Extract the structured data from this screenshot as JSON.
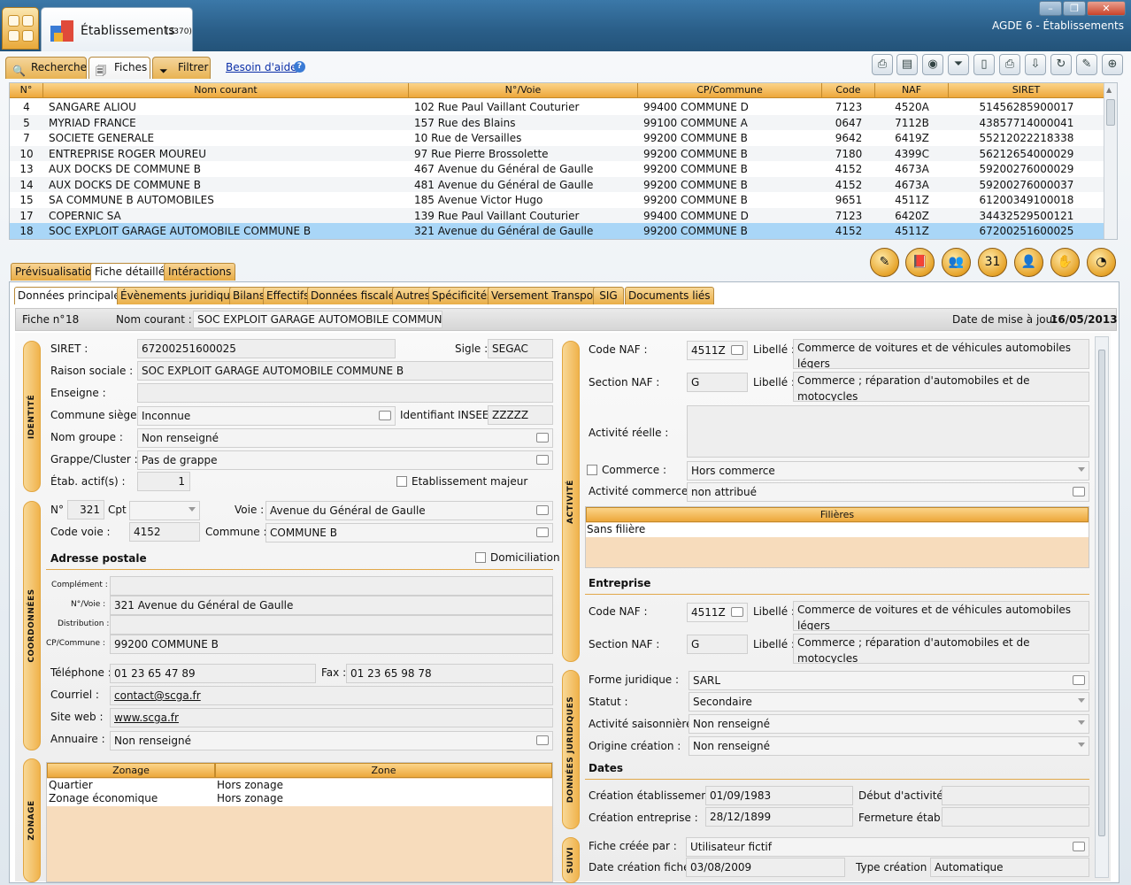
{
  "window": {
    "app_title": "AGDE 6 - Établissements",
    "tab_title": "Établissements",
    "tab_count": "(3370)"
  },
  "toolbar": {
    "tabs": [
      {
        "label": "Recherche",
        "icon": "search-icon"
      },
      {
        "label": "Fiches",
        "icon": "cards-icon"
      },
      {
        "label": "Filtrer",
        "icon": "filter-icon"
      }
    ],
    "help": "Besoin d'aide",
    "help_icon": "?"
  },
  "grid": {
    "columns": [
      "N°",
      "Nom courant",
      "N°/Voie",
      "CP/Commune",
      "Code",
      "NAF",
      "SIRET"
    ],
    "rows": [
      [
        "4",
        "SANGARE ALIOU",
        "102 Rue Paul Vaillant Couturier",
        "99400 COMMUNE D",
        "7123",
        "4520A",
        "51456285900017"
      ],
      [
        "5",
        "MYRIAD FRANCE",
        "157 Rue des Blains",
        "99100 COMMUNE A",
        "0647",
        "7112B",
        "43857714000041"
      ],
      [
        "7",
        "SOCIETE GENERALE",
        "10 Rue de Versailles",
        "99200 COMMUNE B",
        "9642",
        "6419Z",
        "55212022218338"
      ],
      [
        "10",
        "ENTREPRISE ROGER MOUREU",
        "97 Rue Pierre Brossolette",
        "99200 COMMUNE B",
        "7180",
        "4399C",
        "56212654000029"
      ],
      [
        "13",
        "AUX DOCKS DE COMMUNE B",
        "467 Avenue du Général de Gaulle",
        "99200 COMMUNE B",
        "4152",
        "4673A",
        "59200276000029"
      ],
      [
        "14",
        "AUX DOCKS DE COMMUNE B",
        "481 Avenue du Général de Gaulle",
        "99200 COMMUNE B",
        "4152",
        "4673A",
        "59200276000037"
      ],
      [
        "15",
        "SA COMMUNE B AUTOMOBILES",
        "185 Avenue Victor Hugo",
        "99200 COMMUNE B",
        "9651",
        "4511Z",
        "61200349100018"
      ],
      [
        "17",
        "COPERNIC SA",
        "139  Rue Paul Vaillant Couturier",
        "99400 COMMUNE D",
        "7123",
        "6420Z",
        "34432529500121"
      ],
      [
        "18",
        "SOC EXPLOIT GARAGE AUTOMOBILE COMMUNE B",
        "321 Avenue du Général de Gaulle",
        "99200 COMMUNE B",
        "4152",
        "4511Z",
        "67200251600025"
      ]
    ],
    "selected_index": 8
  },
  "detail_tabs": [
    "Prévisualisation",
    "Fiche détaillée",
    "Intéractions"
  ],
  "inner_tabs": [
    "Données principales",
    "Évènements juridiques",
    "Bilans",
    "Effectifs",
    "Données fiscales",
    "Autres",
    "Spécificités",
    "Versement Transport",
    "SIG",
    "Documents liés"
  ],
  "info": {
    "fiche_label": "Fiche n°",
    "fiche_no": "18",
    "nom_label": "Nom courant :",
    "nom_value": "SOC EXPLOIT GARAGE AUTOMOBILE COMMUNE B",
    "maj_label": "Date de mise à jour :",
    "maj_value": "16/05/2013"
  },
  "sections": {
    "identite": "IDENTITÉ",
    "coordonnees": "COORDONNÉES",
    "zonage": "ZONAGE",
    "activite": "ACTIVITÉ",
    "juridique": "DONNÉES JURIDIQUES",
    "suivi": "SUIVI"
  },
  "identite": {
    "siret_l": "SIRET :",
    "siret": "67200251600025",
    "sigle_l": "Sigle :",
    "sigle": "SEGAC",
    "raison_l": "Raison sociale :",
    "raison": "SOC EXPLOIT GARAGE AUTOMOBILE COMMUNE B",
    "enseigne_l": "Enseigne :",
    "enseigne": "",
    "commune_l": "Commune siège :",
    "commune": "Inconnue",
    "insee_l": "Identifiant INSEE :",
    "insee": "ZZZZZ",
    "groupe_l": "Nom groupe :",
    "groupe": "Non renseigné",
    "grappe_l": "Grappe/Cluster :",
    "grappe": "Pas de grappe",
    "actif_l": "Étab. actif(s) :",
    "actif": "1",
    "majeur_l": "Etablissement majeur"
  },
  "coord": {
    "no_l": "N°",
    "no": "321",
    "cpt_l": "Cpt",
    "voie_l": "Voie :",
    "voie": "Avenue du Général de Gaulle",
    "codevoie_l": "Code voie :",
    "codevoie": "4152",
    "commune_l": "Commune :",
    "commune": "COMMUNE B",
    "adr_title": "Adresse postale",
    "domic_l": "Domiciliation",
    "compl_l": "Complément :",
    "compl": "",
    "nvoie_l": "N°/Voie :",
    "nvoie": "321 Avenue du Général de Gaulle",
    "distrib_l": "Distribution :",
    "distrib": "",
    "cp_l": "CP/Commune :",
    "cp": "99200 COMMUNE B",
    "tel_l": "Téléphone :",
    "tel": "01 23 65 47 89",
    "fax_l": "Fax :",
    "fax": "01 23 65 98 78",
    "mail_l": "Courriel :",
    "mail": "contact@scga.fr",
    "web_l": "Site web :",
    "web": "www.scga.fr",
    "annuaire_l": "Annuaire :",
    "annuaire": "Non renseigné"
  },
  "zonage": {
    "head": [
      "Zonage",
      "Zone"
    ],
    "rows": [
      [
        "Quartier",
        "Hors zonage"
      ],
      [
        "Zonage économique",
        "Hors zonage"
      ]
    ]
  },
  "activite": {
    "naf_l": "Code NAF :",
    "naf": "4511Z",
    "lib_l": "Libellé :",
    "naf_lib": "Commerce de voitures et de véhicules automobiles légers",
    "sec_l": "Section NAF :",
    "sec": "G",
    "sec_lib": "Commerce ; réparation d'automobiles et de motocycles",
    "reelle_l": "Activité réelle :",
    "reelle": "",
    "commerce_l": "Commerce :",
    "commerce": "Hors commerce",
    "actcom_l": "Activité commerce :",
    "actcom": "non attribué",
    "filieres_head": "Filières",
    "filiere": "Sans filière",
    "ent_title": "Entreprise",
    "e_naf": "4511Z",
    "e_naf_lib": "Commerce de voitures et de véhicules automobiles légers",
    "e_sec": "G",
    "e_sec_lib": "Commerce ; réparation d'automobiles et de motocycles"
  },
  "juridique": {
    "forme_l": "Forme juridique :",
    "forme": "SARL",
    "statut_l": "Statut :",
    "statut": "Secondaire",
    "saison_l": "Activité saisonnière :",
    "saison": "Non renseigné",
    "origine_l": "Origine création :",
    "origine": "Non renseigné",
    "dates_title": "Dates",
    "creat_l": "Création établissement :",
    "creat": "01/09/1983",
    "debut_l": "Début d'activité :",
    "debut": "",
    "creat_ent_l": "Création entreprise :",
    "creat_ent": "28/12/1899",
    "ferm_l": "Fermeture étab. :",
    "ferm": ""
  },
  "suivi": {
    "par_l": "Fiche créée par :",
    "par": "Utilisateur fictif",
    "date_l": "Date création fiche :",
    "date": "03/08/2009",
    "type_l": "Type création :",
    "type": "Automatique"
  }
}
